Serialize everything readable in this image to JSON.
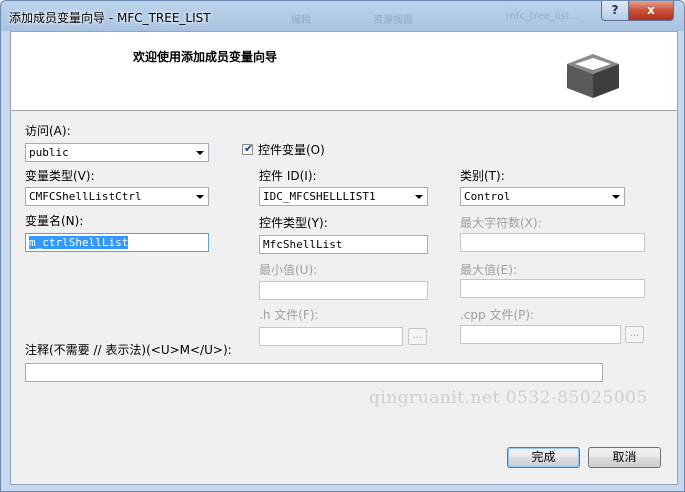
{
  "window": {
    "title": "添加成员变量向导 - MFC_TREE_LIST",
    "ghost_tabs": [
      "编辑",
      "资源视图",
      "mfc_tree_list..."
    ],
    "help_label": "?",
    "close_label": "x"
  },
  "header": {
    "title": "欢迎使用添加成员变量向导",
    "icon": "box-3d-icon"
  },
  "form": {
    "access_label": "访问(A):",
    "access_value": "public",
    "control_var_label": "控件变量(O)",
    "control_var_checked": true,
    "var_type_label": "变量类型(V):",
    "var_type_value": "CMFCShellListCtrl",
    "control_id_label": "控件 ID(I):",
    "control_id_value": "IDC_MFCSHELLLIST1",
    "category_label": "类别(T):",
    "category_value": "Control",
    "var_name_label": "变量名(N):",
    "var_name_value": "m_ctrlShellList",
    "control_type_label": "控件类型(Y):",
    "control_type_value": "MfcShellList",
    "max_chars_label": "最大字符数(X):",
    "max_chars_value": "",
    "min_label": "最小值(U):",
    "min_value": "",
    "max_label": "最大值(E):",
    "max_value": "",
    "h_file_label": ".h 文件(F):",
    "h_file_value": "",
    "cpp_file_label": ".cpp 文件(P):",
    "cpp_file_value": "",
    "browse_label": "...",
    "comment_label": "注释(不需要 // 表示法)(<U>M</U>):",
    "comment_value": ""
  },
  "footer": {
    "finish_label": "完成",
    "cancel_label": "取消"
  },
  "watermark": "qingruanit.net 0532-85025005"
}
